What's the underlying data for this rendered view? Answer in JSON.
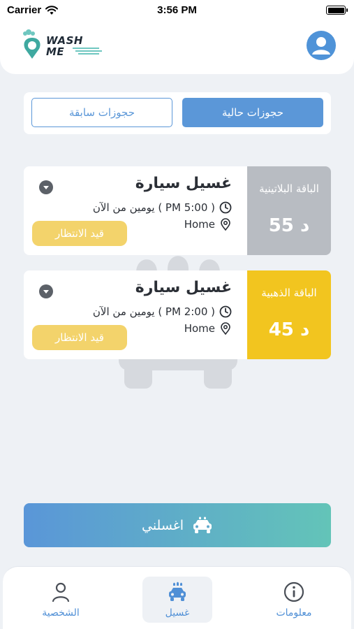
{
  "status_bar": {
    "carrier": "Carrier",
    "time": "3:56 PM"
  },
  "header": {
    "logo_line1": "WASH",
    "logo_line2": "ME"
  },
  "tabs": {
    "current": "حجوزات حالية",
    "previous": "حجوزات سابقة"
  },
  "bookings": [
    {
      "service": "غسيل سيارة",
      "time": "يومين من الآن ( PM 5:00 )",
      "location": "Home",
      "status": "قيد الانتظار",
      "package_name": "الباقة البلاتينية",
      "price": "55 د",
      "package_color": "#b8bcc2"
    },
    {
      "service": "غسيل سيارة",
      "time": "يومين من الآن ( PM 2:00 )",
      "location": "Home",
      "status": "قيد الانتظار",
      "package_name": "الباقة الذهبية",
      "price": "45 د",
      "package_color": "#f2c51f"
    }
  ],
  "wash_button": {
    "label": "اغسلني",
    "icon": "car-icon"
  },
  "bottom_nav": [
    {
      "label": "الشخصية",
      "icon": "person-icon"
    },
    {
      "label": "غسيل",
      "icon": "car-wash-icon",
      "active": true
    },
    {
      "label": "معلومات",
      "icon": "info-icon"
    }
  ],
  "colors": {
    "primary": "#5b97d8",
    "accent_teal": "#63c4b8",
    "pending_badge": "#f3d36b",
    "background": "#eef1f5"
  }
}
